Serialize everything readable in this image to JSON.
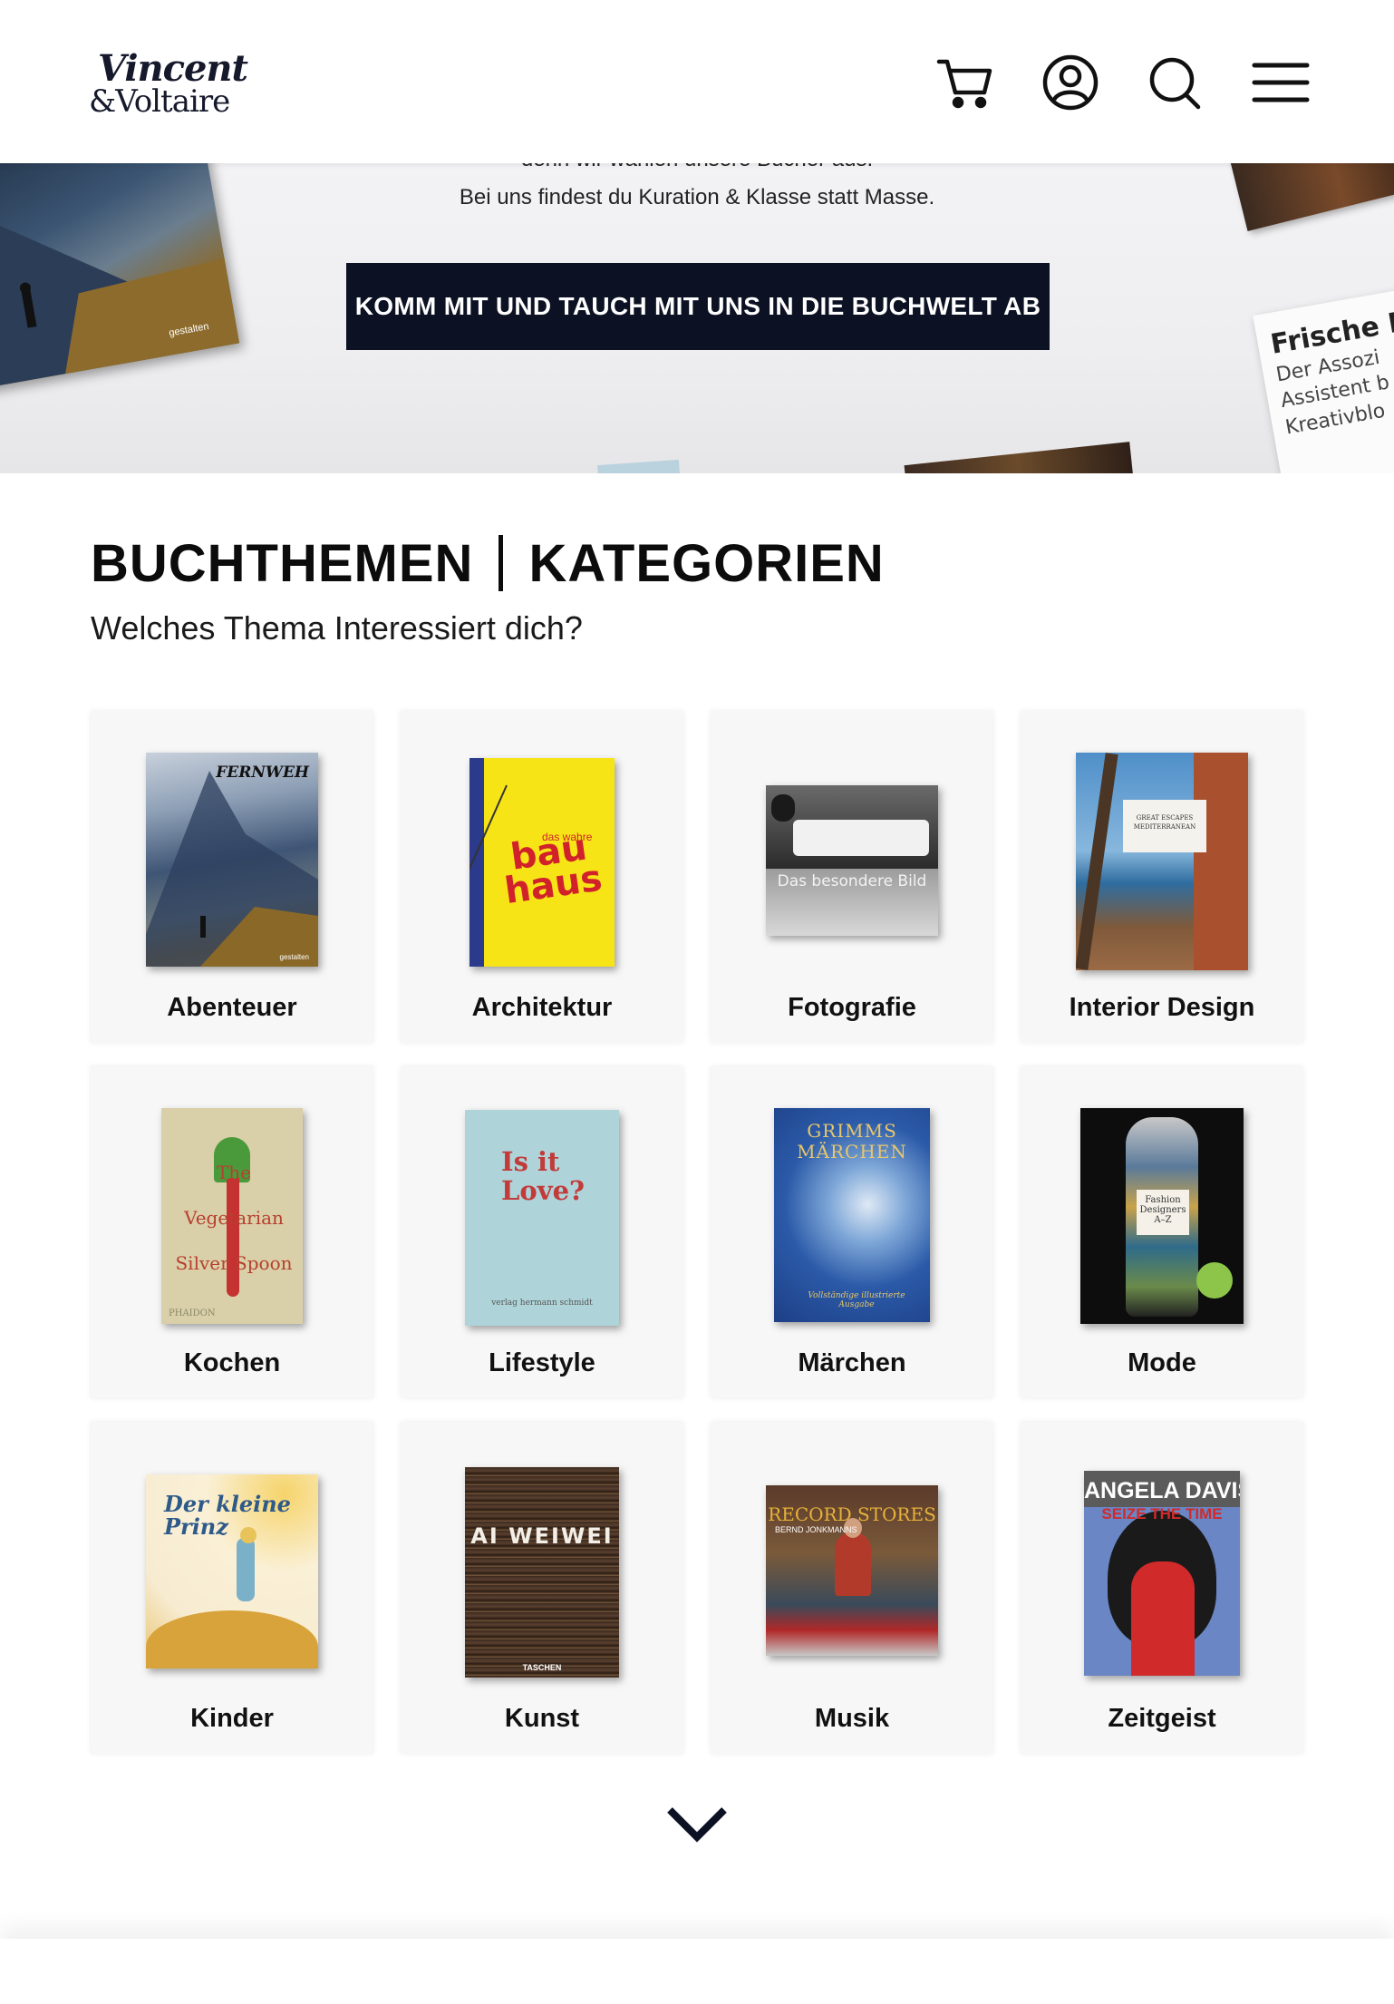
{
  "brand": {
    "logo_line1": "Vincent",
    "logo_line2": "&Voltaire"
  },
  "header": {
    "icons": [
      "cart-icon",
      "user-icon",
      "search-icon",
      "menu-icon"
    ]
  },
  "hero": {
    "line1": "denn wir wählen unsere Bücher aus.",
    "line2": "Bei uns findest du Kuration & Klasse statt Masse.",
    "cta_label": "KOMM MIT UND TAUCH MIT UNS IN DIE BUCHWELT AB",
    "photo1_brand": "gestalten",
    "card_title": "Frische L",
    "card_line1": "Der Assozi",
    "card_line2": "Assistent b",
    "card_line3": "Kreativblo"
  },
  "section": {
    "title_left": "BUCHTHEMEN",
    "title_right": "KATEGORIEN",
    "subtitle": "Welches Thema Interessiert dich?"
  },
  "categories": [
    {
      "label": "Abenteuer",
      "cover_text": "FERNWEH",
      "cover_sub": "gestalten"
    },
    {
      "label": "Architektur",
      "cover_text": "bau haus",
      "cover_sub": "das wahre"
    },
    {
      "label": "Fotografie",
      "cover_text": "Das besondere Bild",
      "cover_sub": ""
    },
    {
      "label": "Interior Design",
      "cover_text": "GREAT ESCAPES MEDITERRANEAN",
      "cover_sub": ""
    },
    {
      "label": "Kochen",
      "cover_text": "The Vegetarian Silver Spoon",
      "cover_sub": "PHAIDON"
    },
    {
      "label": "Lifestyle",
      "cover_text": "Is it Love?",
      "cover_sub": "verlag hermann schmidt"
    },
    {
      "label": "Märchen",
      "cover_text": "GRIMMS MÄRCHEN",
      "cover_sub": "Vollständige illustrierte Ausgabe"
    },
    {
      "label": "Mode",
      "cover_text": "Fashion Designers A–Z",
      "cover_sub": ""
    },
    {
      "label": "Kinder",
      "cover_text": "Der kleine Prinz",
      "cover_sub": ""
    },
    {
      "label": "Kunst",
      "cover_text": "AI WEIWEI",
      "cover_sub": "TASCHEN"
    },
    {
      "label": "Musik",
      "cover_text": "RECORD STORES",
      "cover_sub": "BERND JONKMANNS"
    },
    {
      "label": "Zeitgeist",
      "cover_text": "ANGELA DAVIS",
      "cover_sub": "SEIZE THE TIME"
    }
  ],
  "colors": {
    "primary_dark": "#0c1223",
    "tile_bg": "#f7f7f7"
  }
}
